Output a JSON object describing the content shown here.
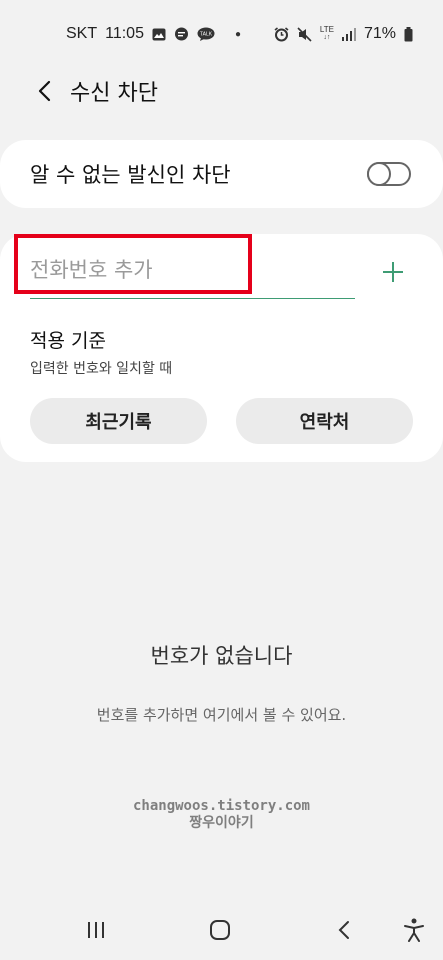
{
  "status_bar": {
    "carrier": "SKT",
    "time": "11:05",
    "network": "LTE",
    "battery": "71%",
    "icons_left": [
      "gallery-icon",
      "chat-icon",
      "talk-icon",
      "dot"
    ],
    "icons_right": [
      "alarm-icon",
      "mute-icon",
      "lte-icon",
      "signal-icon",
      "battery-icon"
    ]
  },
  "header": {
    "title": "수신 차단"
  },
  "unknown_callers": {
    "label": "알 수 없는 발신인 차단",
    "enabled": false
  },
  "add_number": {
    "placeholder": "전화번호 추가",
    "value": "",
    "criteria_title": "적용 기준",
    "criteria_desc": "입력한 번호와 일치할 때",
    "recent_button": "최근기록",
    "contacts_button": "연락처"
  },
  "empty_state": {
    "title": "번호가 없습니다",
    "description": "번호를 추가하면 여기에서 볼 수 있어요."
  },
  "watermark": {
    "line1": "changwoos.tistory.com",
    "line2": "짱우이야기"
  },
  "colors": {
    "background": "#f2f2f2",
    "card": "#ffffff",
    "accent": "#3e9c74",
    "highlight": "#e5001a"
  }
}
